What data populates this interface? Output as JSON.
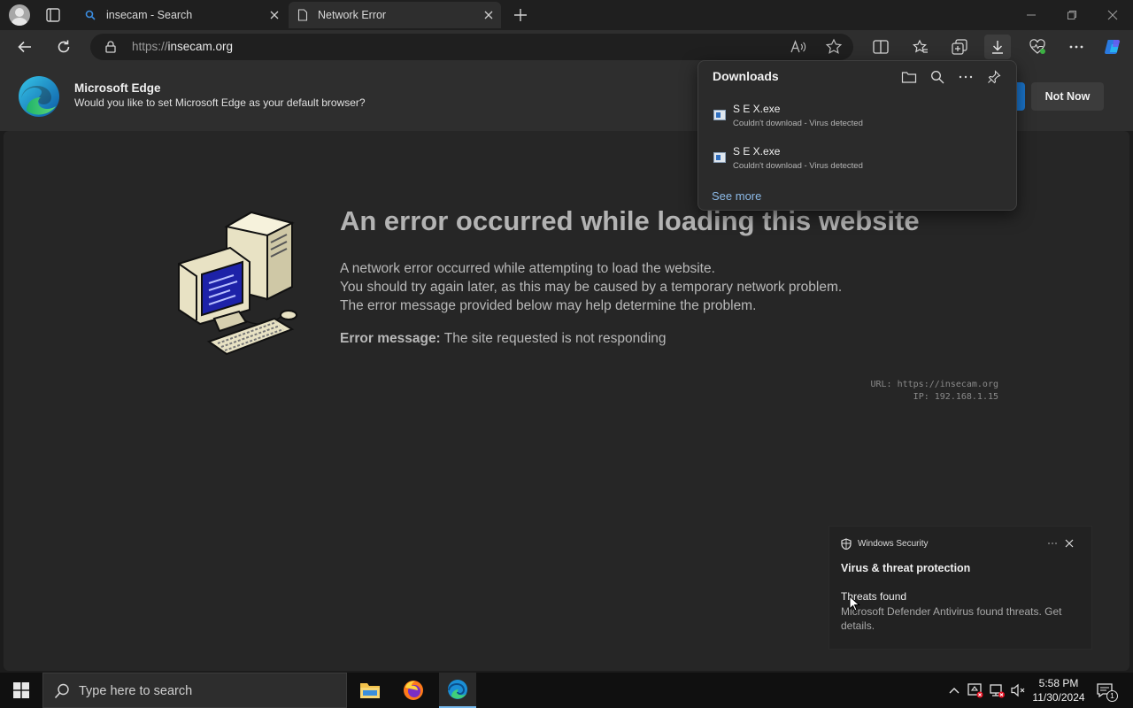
{
  "tabs": [
    {
      "title": "insecam - Search",
      "icon": "search-icon"
    },
    {
      "title": "Network Error",
      "icon": "page-icon"
    }
  ],
  "address": {
    "scheme": "https://",
    "host": "insecam.org"
  },
  "infobar": {
    "title": "Microsoft Edge",
    "message": "Would you like to set Microsoft Edge as your default browser?",
    "not_now_label": "Not Now"
  },
  "error_page": {
    "title": "An error occurred while loading this website",
    "lines": [
      "A network error occurred while attempting to load the website.",
      "You should try again later, as this may be caused by a temporary network problem.",
      "The error message provided below may help determine the problem."
    ],
    "error_label": "Error message:",
    "error_value": "The site requested is not responding",
    "url_line": "URL: https://insecam.org",
    "ip_line": "IP: 192.168.1.15"
  },
  "downloads": {
    "title": "Downloads",
    "items": [
      {
        "name": "S E X.exe",
        "status": "Couldn't download - Virus detected"
      },
      {
        "name": "S E X.exe",
        "status": "Couldn't download - Virus detected"
      }
    ],
    "see_more": "See more"
  },
  "toast": {
    "app": "Windows Security",
    "heading": "Virus & threat protection",
    "title": "Threats found",
    "body": "Microsoft Defender Antivirus found threats. Get details."
  },
  "taskbar": {
    "search_placeholder": "Type here to search",
    "time": "5:58 PM",
    "date": "11/30/2024",
    "notification_count": "1"
  },
  "colors": {
    "accent": "#1a73c9",
    "link": "#8cb9e6"
  }
}
